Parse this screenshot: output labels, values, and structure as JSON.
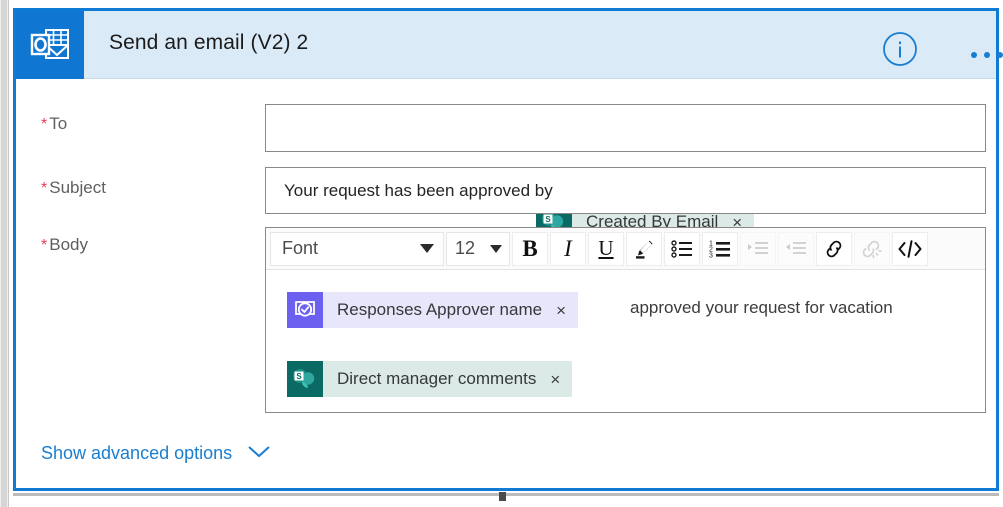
{
  "window": {
    "accent_color": "#0f7bd4",
    "header_bg": "#dbeaf7"
  },
  "header": {
    "title": "Send an email (V2) 2",
    "app_icon": "outlook-icon",
    "info_icon": "info-icon",
    "more_icon": "ellipsis-icon"
  },
  "fields": {
    "to": {
      "label": "To",
      "required_marker": "*",
      "token": {
        "label": "Created By Email",
        "icon": "sharepoint-icon",
        "remove": "×",
        "icon_color": "#0b6a64",
        "chip_color": "#dbe9e7"
      }
    },
    "subject": {
      "label": "Subject",
      "required_marker": "*",
      "value": "Your request has been approved by"
    },
    "body": {
      "label": "Body",
      "required_marker": "*",
      "toolbar": {
        "font_name": "Font",
        "font_size": "12",
        "bold": "B",
        "italic": "I",
        "underline": "U",
        "highlight_icon": "highlighter-pen-icon",
        "bulleted_list_icon": "bulleted-list-icon",
        "numbered_list_icon": "numbered-list-icon",
        "indent_icon": "increase-indent-icon",
        "outdent_icon": "decrease-indent-icon",
        "link_icon": "insert-link-icon",
        "unlink_icon": "remove-link-icon",
        "code_view_icon": "code-view-icon"
      },
      "tokens": [
        {
          "label": "Responses Approver name",
          "icon": "approvals-icon",
          "remove": "×",
          "icon_color": "#6b60f0",
          "chip_color": "#e8e6fb"
        },
        {
          "label": "Direct manager comments",
          "icon": "sharepoint-icon",
          "remove": "×",
          "icon_color": "#0b6a64",
          "chip_color": "#dbe9e7"
        }
      ],
      "text": "approved your request for vacation"
    }
  },
  "footer": {
    "advanced_options_label": "Show advanced options",
    "chevron_icon": "chevron-down-icon",
    "link_color": "#1a7ed0"
  }
}
